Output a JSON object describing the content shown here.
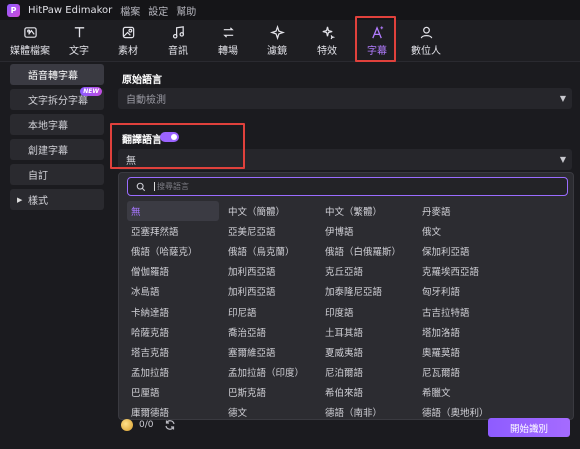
{
  "titlebar": {
    "app_name": "HitPaw Edimakor",
    "logo_glyph": "P",
    "menu": [
      "檔案",
      "設定",
      "幫助"
    ]
  },
  "toolbar": {
    "tools": [
      {
        "label": "媒體檔案",
        "icon": "media-icon"
      },
      {
        "label": "文字",
        "icon": "text-icon"
      },
      {
        "label": "素材",
        "icon": "assets-icon"
      },
      {
        "label": "音訊",
        "icon": "audio-icon"
      },
      {
        "label": "轉場",
        "icon": "transition-icon"
      },
      {
        "label": "濾鏡",
        "icon": "filter-icon"
      },
      {
        "label": "特效",
        "icon": "effects-icon"
      },
      {
        "label": "字幕",
        "icon": "subtitle-icon",
        "active": true
      },
      {
        "label": "數位人",
        "icon": "digital-human-icon"
      }
    ],
    "accent_color": "#b27cff"
  },
  "sidebar": {
    "items": [
      {
        "label": "語音轉字幕",
        "active": true
      },
      {
        "label": "文字拆分字幕",
        "badge": "NEW"
      },
      {
        "label": "本地字幕"
      },
      {
        "label": "創建字幕"
      },
      {
        "label": "自訂"
      },
      {
        "label": "樣式",
        "caret": "▶"
      }
    ]
  },
  "main": {
    "source_language": {
      "title": "原始語言",
      "value": "自動檢測"
    },
    "translation": {
      "title": "翻譯語言",
      "enabled": true,
      "value": "無"
    },
    "search": {
      "placeholder": "搜尋語言"
    },
    "languages": [
      "無",
      "中文（簡體）",
      "中文（繁體）",
      "丹麥語",
      "亞塞拜然語",
      "亞美尼亞語",
      "伊博語",
      "俄文",
      "俄語（哈薩克）",
      "俄語（烏克蘭）",
      "俄語（白俄羅斯）",
      "保加利亞語",
      "僧伽羅語",
      "加利西亞語",
      "克丘亞語",
      "克羅埃西亞語",
      "冰島語",
      "加利西亞語",
      "加泰隆尼亞語",
      "匈牙利語",
      "卡納達語",
      "印尼語",
      "印度語",
      "古吉拉特語",
      "哈薩克語",
      "喬治亞語",
      "土耳其語",
      "塔加洛語",
      "塔吉克語",
      "塞爾維亞語",
      "夏威夷語",
      "奧羅莫語",
      "孟加拉語",
      "孟加拉語（印度）",
      "尼泊爾語",
      "尼瓦爾語",
      "巴厘語",
      "巴斯克語",
      "希伯來語",
      "希臘文",
      "庫爾德語",
      "德文",
      "德語（南非）",
      "德語（奧地利）"
    ],
    "selected_language": "無"
  },
  "footer": {
    "credits": "0/0",
    "start_button": "開始識別"
  }
}
